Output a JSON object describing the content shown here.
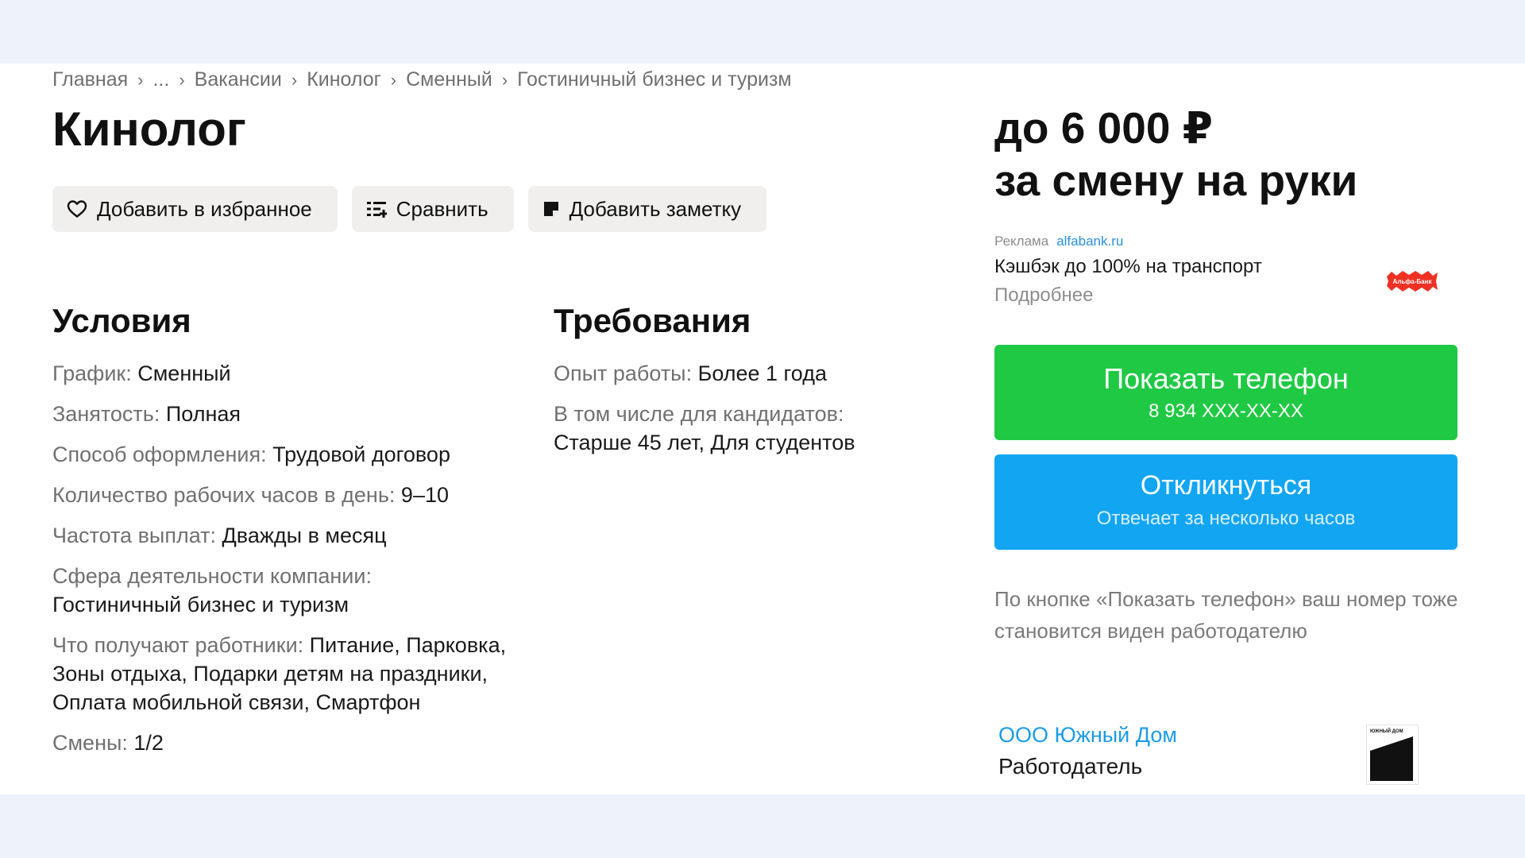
{
  "breadcrumb": {
    "items": [
      "Главная",
      "...",
      "Вакансии",
      "Кинолог",
      "Сменный",
      "Гостиничный бизнес и туризм"
    ]
  },
  "title": "Кинолог",
  "actions": {
    "favorite": "Добавить в избранное",
    "compare": "Сравнить",
    "note": "Добавить заметку"
  },
  "conditions": {
    "heading": "Условия",
    "items": [
      {
        "label": "График: ",
        "value": "Сменный"
      },
      {
        "label": "Занятость: ",
        "value": "Полная"
      },
      {
        "label": "Способ оформления: ",
        "value": "Трудовой договор"
      },
      {
        "label": "Количество рабочих часов в день: ",
        "value": "9–10"
      },
      {
        "label": "Частота выплат: ",
        "value": "Дважды в месяц"
      },
      {
        "label": "Сфера деятельности компании: ",
        "value": "Гостиничный бизнес и туризм"
      },
      {
        "label": "Что получают работники: ",
        "value": "Питание, Парковка, Зоны отдыха, Подарки детям на праздники, Оплата мобильной связи, Смартфон"
      },
      {
        "label": "Смены: ",
        "value": "1/2"
      }
    ]
  },
  "requirements": {
    "heading": "Требования",
    "items": [
      {
        "label": "Опыт работы: ",
        "value": "Более 1 года"
      },
      {
        "label": "В том числе для кандидатов: ",
        "value": "Старше 45 лет, Для студентов"
      }
    ]
  },
  "salary": {
    "line1": "до 6 000 ₽",
    "line2": "за смену на руки"
  },
  "ad": {
    "label": "Реклама",
    "link": "alfabank.ru",
    "text": "Кэшбэк до 100% на транспорт",
    "more": "Подробнее",
    "logo_text": "Альфа-Банк",
    "logo_color": "#ef3124"
  },
  "phone_button": {
    "label": "Показать телефон",
    "number": "8 934 XXX-XX-XX",
    "color": "#20c944"
  },
  "respond_button": {
    "label": "Откликнуться",
    "sub": "Отвечает за несколько часов",
    "color": "#12a5f2"
  },
  "hint": "По кнопке «Показать телефон» ваш номер тоже становится виден работодателю",
  "employer": {
    "name": "ООО Южный Дом",
    "role": "Работодатель",
    "logo_text": "ЮЖНЫЙ ДОМ"
  }
}
